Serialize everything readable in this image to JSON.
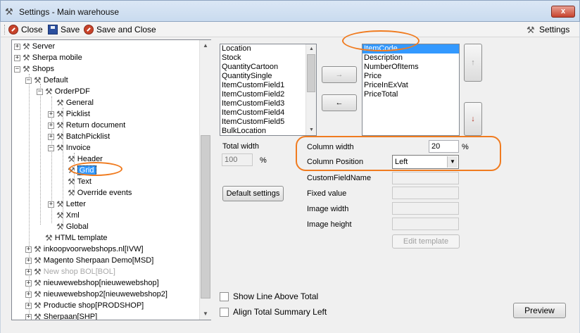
{
  "window": {
    "title": "Settings - Main warehouse",
    "close_glyph": "x"
  },
  "toolbar": {
    "close_label": "Close",
    "save_label": "Save",
    "save_close_label": "Save and Close",
    "settings_label": "Settings"
  },
  "tree": {
    "items": [
      {
        "label": "Server"
      },
      {
        "label": "Sherpa mobile"
      },
      {
        "label": "Shops"
      },
      {
        "label": "Default"
      },
      {
        "label": "OrderPDF"
      },
      {
        "label": "General"
      },
      {
        "label": "Picklist"
      },
      {
        "label": "Return document"
      },
      {
        "label": "BatchPicklist"
      },
      {
        "label": "Invoice"
      },
      {
        "label": "Header"
      },
      {
        "label": "Grid"
      },
      {
        "label": "Text"
      },
      {
        "label": "Override events"
      },
      {
        "label": "Letter"
      },
      {
        "label": "Xml"
      },
      {
        "label": "Global"
      },
      {
        "label": "HTML template"
      },
      {
        "label": "inkoopvoorwebshops.nl[IVW]"
      },
      {
        "label": "Magento Sherpaan Demo[MSD]"
      },
      {
        "label": "New shop BOL[BOL]"
      },
      {
        "label": "nieuwewebshop[nieuwewebshop]"
      },
      {
        "label": "nieuwewebshop2[nieuwewebshop2]"
      },
      {
        "label": "Productie shop[PRODSHOP]"
      },
      {
        "label": "Sherpaan[SHP]"
      }
    ]
  },
  "available_fields": [
    "Location",
    "Stock",
    "QuantityCartoon",
    "QuantitySingle",
    "ItemCustomField1",
    "ItemCustomField2",
    "ItemCustomField3",
    "ItemCustomField4",
    "ItemCustomField5",
    "BulkLocation"
  ],
  "selected_fields": [
    "ItemCode",
    "Description",
    "NumberOfItems",
    "Price",
    "PriceInExVat",
    "PriceTotal"
  ],
  "arrows": {
    "add": "→",
    "remove": "←",
    "up": "↑",
    "down": "↓"
  },
  "total_width": {
    "label": "Total width",
    "value": "100",
    "unit": "%"
  },
  "default_settings_label": "Default settings",
  "column": {
    "width_label": "Column width",
    "width_value": "20",
    "width_unit": "%",
    "position_label": "Column Position",
    "position_value": "Left",
    "custom_field_label": "CustomFieldName",
    "fixed_value_label": "Fixed value",
    "image_width_label": "Image width",
    "image_height_label": "Image height",
    "edit_template_label": "Edit template"
  },
  "checkboxes": {
    "show_line_label": "Show Line Above Total",
    "align_total_label": "Align Total Summary Left"
  },
  "preview_label": "Preview",
  "colors": {
    "selection": "#3399ff",
    "annotation": "#f07b1f",
    "disabled_text": "#a8a8a8"
  },
  "icons": {
    "app": "tools-icon",
    "close": "close-circle-icon",
    "save": "floppy-icon",
    "settings": "tools-icon"
  }
}
